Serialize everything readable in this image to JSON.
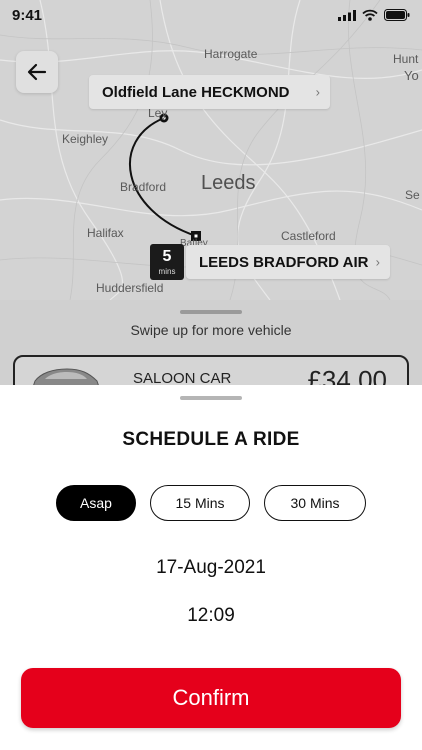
{
  "status_bar": {
    "time": "9:41"
  },
  "map": {
    "places": {
      "harrogate": "Harrogate",
      "hunt": "Hunt",
      "yo": "Yo",
      "ley": "Ley",
      "keighley": "Keighley",
      "bradford": "Bradford",
      "leeds": "Leeds",
      "se": "Se",
      "halifax": "Halifax",
      "batley": "Batley",
      "castleford": "Castleford",
      "huddersfield": "Huddersfield"
    },
    "icons": {
      "back": "arrow-left-icon",
      "chevron": "chevron-right-icon"
    }
  },
  "route": {
    "pickup_label": "Oldfield Lane HECKMOND",
    "dropoff_label": "LEEDS BRADFORD AIR",
    "eta_value": "5",
    "eta_unit": "mins"
  },
  "vehicles": {
    "swipe_hint": "Swipe up for more vehicle",
    "selected": {
      "name": "SALOON CAR",
      "price": "£34.00"
    }
  },
  "schedule": {
    "title": "SCHEDULE A RIDE",
    "options": [
      {
        "label": "Asap",
        "active": true
      },
      {
        "label": "15 Mins",
        "active": false
      },
      {
        "label": "30 Mins",
        "active": false
      }
    ],
    "date": "17-Aug-2021",
    "time": "12:09",
    "confirm_label": "Confirm"
  },
  "colors": {
    "accent": "#E5001B",
    "active_chip": "#000000",
    "map_bg": "#D3D3D3"
  }
}
